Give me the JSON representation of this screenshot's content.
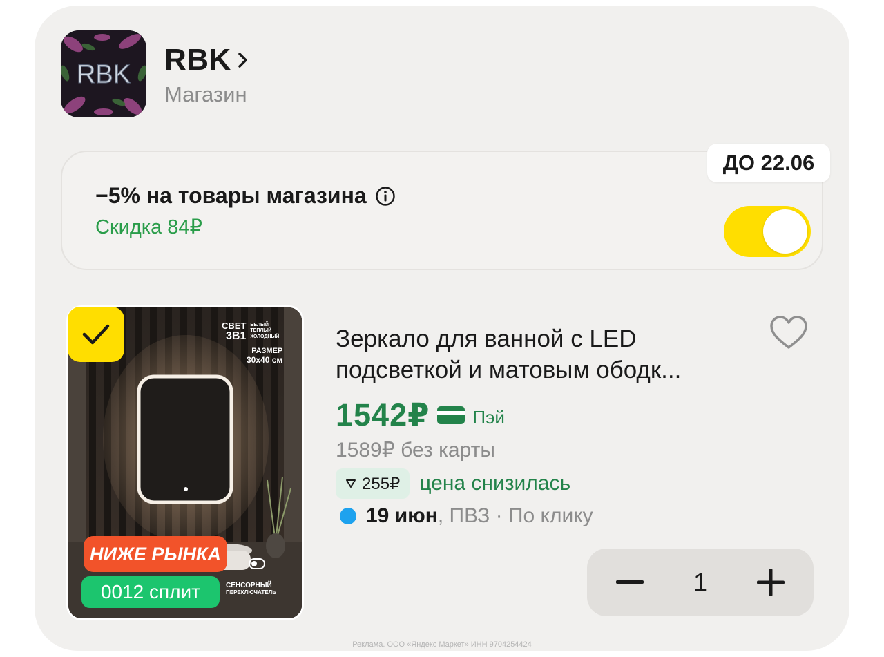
{
  "store": {
    "logo_text": "RBK",
    "name": "RBK",
    "subtitle": "Магазин"
  },
  "promo": {
    "badge": "ДО 22.06",
    "title": "−5% на товары магазина",
    "discount": "Скидка 84₽",
    "toggle_on": true
  },
  "product": {
    "title_line1": "Зеркало для ванной с LED",
    "title_line2": "подсветкой и матовым ободк...",
    "selected": true,
    "favorite": false,
    "price": "1542₽",
    "pay_label": "Пэй",
    "old_price": "1589₽ без карты",
    "price_drop_amount": "255₽",
    "price_drop_text": "цена снизилась",
    "delivery_date": "19 июн",
    "delivery_rest": ", ПВЗ · По клику",
    "quantity": "1",
    "image_labels": {
      "market_tag": "НИЖЕ РЫНКА",
      "split_tag": "0012 сплит",
      "light_title": "СВЕТ",
      "light_modes": "3В1",
      "light_opts": [
        "БЕЛЫЙ",
        "ТЕПЛЫЙ",
        "ХОЛОДНЫЙ"
      ],
      "size_title": "РАЗМЕР",
      "size_value": "30x40 см",
      "sensor_1": "СЕНСОРНЫЙ",
      "sensor_2": "ПЕРЕКЛЮЧАТЕЛЬ"
    }
  },
  "colors": {
    "accent_yellow": "#ffde00",
    "price_green": "#23834a",
    "delivery_blue": "#1ea2ee"
  },
  "footer": {
    "legal": "Реклама. ООО «Яндекс Маркет» ИНН 9704254424"
  }
}
